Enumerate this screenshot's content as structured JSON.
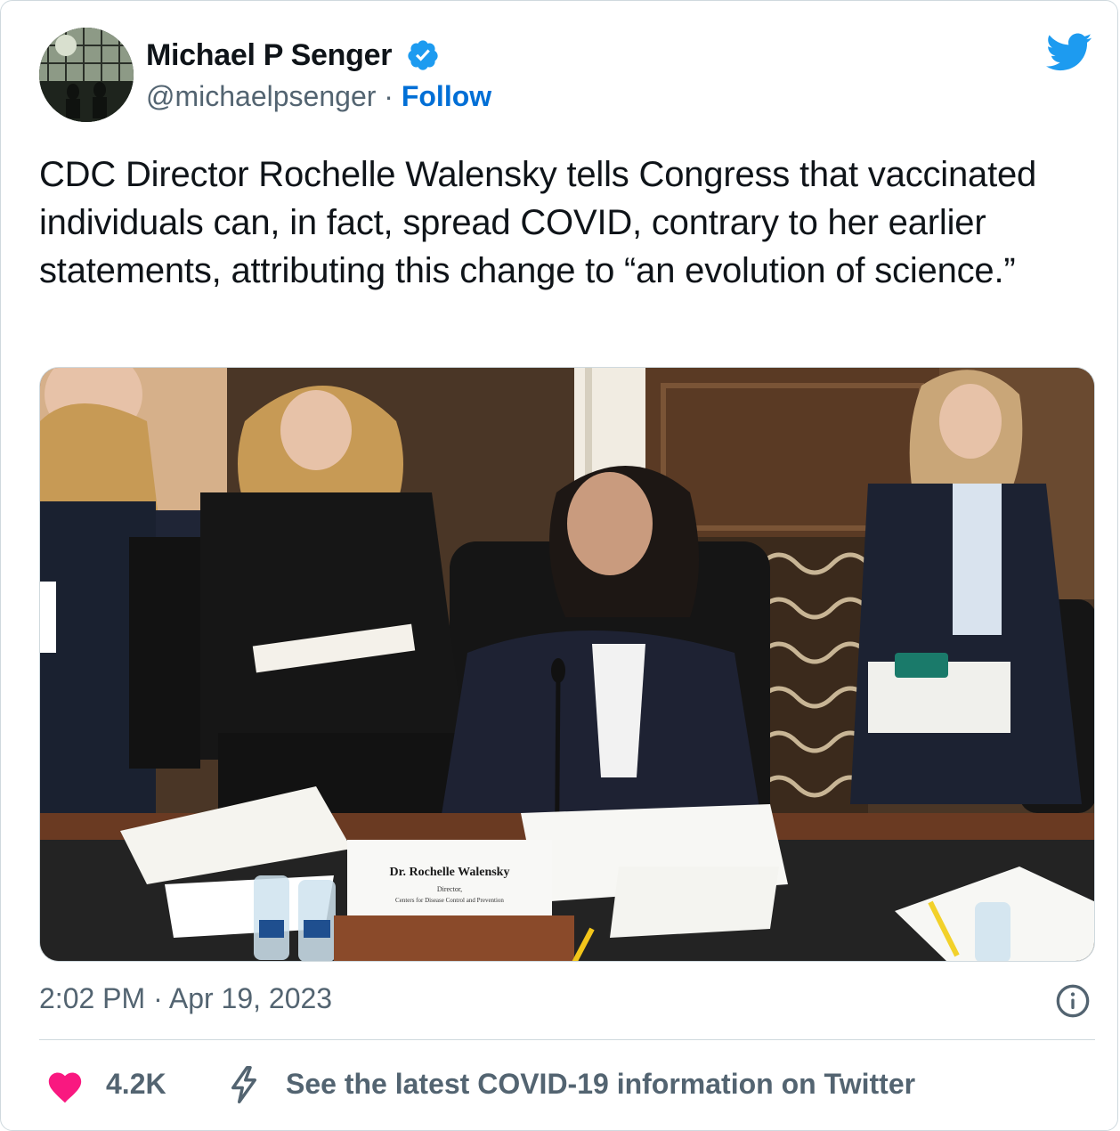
{
  "tweet": {
    "author_name": "Michael P Senger",
    "handle": "@michaelpsenger",
    "separator": "·",
    "follow_label": "Follow",
    "text": "CDC Director Rochelle Walensky tells Congress that vaccinated individuals can, in fact, spread COVID, contrary to her earlier statements, attributing this change to “an evolution of science.”",
    "timestamp": "2:02 PM · Apr 19, 2023",
    "like_count": "4.2K",
    "covid_link_text": "See the latest COVID-19 information on Twitter"
  },
  "media": {
    "nameplate_name": "Dr. Rochelle Walensky",
    "nameplate_title": "Director,",
    "nameplate_org": "Centers for Disease Control and Prevention"
  },
  "icons": {
    "verified": "verified-badge-icon",
    "twitter": "twitter-bird-icon",
    "info": "info-icon",
    "like": "heart-icon",
    "covid": "lightning-bolt-icon"
  },
  "colors": {
    "follow_blue": "#006fd6",
    "twitter_blue": "#1d9bf0",
    "like_pink": "#f91880",
    "secondary_text": "#536471",
    "primary_text": "#0f1419",
    "border": "#cfd9de"
  }
}
